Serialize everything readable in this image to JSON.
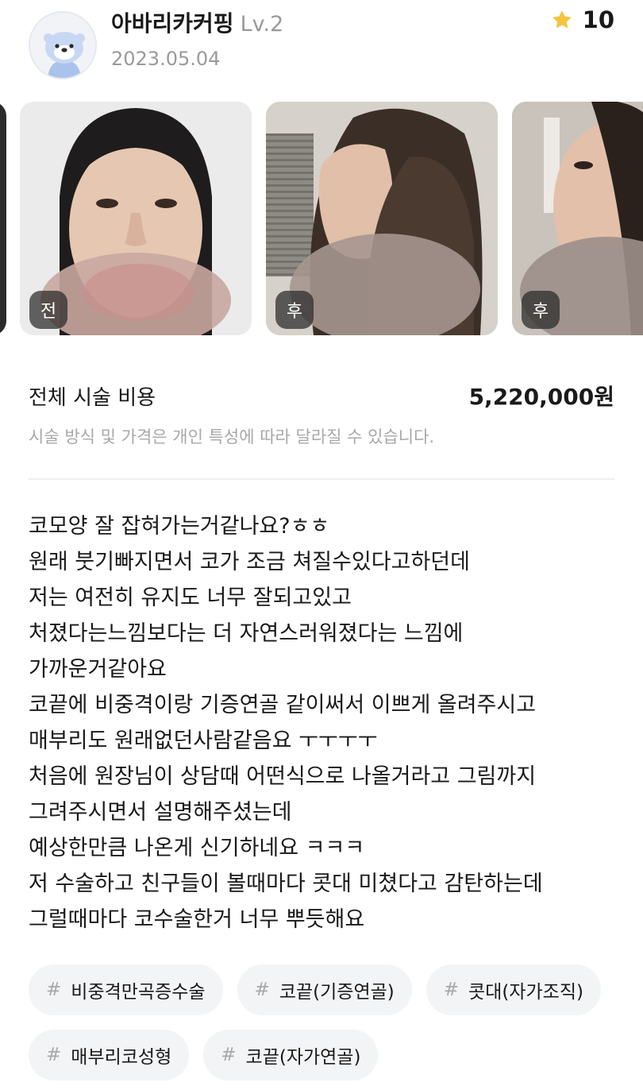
{
  "author": {
    "name": "아바리카커핑",
    "level": "Lv.2",
    "date": "2023.05.04",
    "avatar_icon": "otter-avatar-icon"
  },
  "rating": {
    "icon": "star-icon",
    "value": "10",
    "color": "#f5c43c"
  },
  "photos": [
    {
      "label": "전"
    },
    {
      "label": "후"
    },
    {
      "label": "후"
    }
  ],
  "cost": {
    "label": "전체 시술 비용",
    "value": "5,220,000원",
    "note": "시술 방식 및 가격은 개인 특성에 따라 달라질 수 있습니다."
  },
  "review": {
    "lines": [
      "코모양 잘 잡혀가는거같나요?ㅎㅎ",
      "원래 붓기빠지면서 코가 조금 쳐질수있다고하던데",
      "저는 여전히 유지도 너무 잘되고있고",
      "처졌다는느낌보다는 더 자연스러워졌다는 느낌에",
      "가까운거같아요",
      "코끝에 비중격이랑 기증연골 같이써서 이쁘게 올려주시고",
      "매부리도 원래없던사람같음요 ㅜㅜㅜㅜ",
      "처음에 원장님이 상담때 어떤식으로 나올거라고 그림까지",
      "그려주시면서 설명해주셨는데",
      "예상한만큼 나온게 신기하네요 ㅋㅋㅋ",
      "저 수술하고 친구들이 볼때마다 콧대 미쳤다고 감탄하는데",
      "그럴때마다 코수술한거 너무 뿌듯해요"
    ]
  },
  "tags": [
    {
      "hash": "#",
      "label": "비중격만곡증수술"
    },
    {
      "hash": "#",
      "label": "코끝(기증연골)"
    },
    {
      "hash": "#",
      "label": "콧대(자가조직)"
    },
    {
      "hash": "#",
      "label": "매부리코성형"
    },
    {
      "hash": "#",
      "label": "코끝(자가연골)"
    }
  ]
}
